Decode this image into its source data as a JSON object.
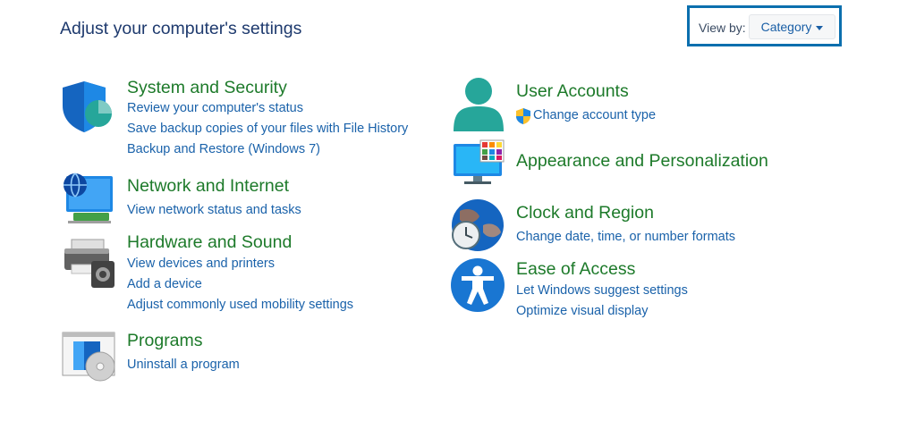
{
  "header": {
    "title": "Adjust your computer's settings",
    "view_by_label": "View by:",
    "view_by_value": "Category"
  },
  "categories": {
    "system": {
      "title": "System and Security",
      "icon": "shield-icon",
      "links": [
        "Review your computer's status",
        "Save backup copies of your files with File History",
        "Backup and Restore (Windows 7)"
      ]
    },
    "network": {
      "title": "Network and Internet",
      "icon": "network-globe-icon",
      "links": [
        "View network status and tasks"
      ]
    },
    "hardware": {
      "title": "Hardware and Sound",
      "icon": "printer-speaker-icon",
      "links": [
        "View devices and printers",
        "Add a device",
        "Adjust commonly used mobility settings"
      ]
    },
    "programs": {
      "title": "Programs",
      "icon": "programs-disc-icon",
      "links": [
        "Uninstall a program"
      ]
    },
    "accounts": {
      "title": "User Accounts",
      "icon": "user-icon",
      "links": [
        "Change account type"
      ]
    },
    "appearance": {
      "title": "Appearance and Personalization",
      "icon": "monitor-palette-icon",
      "links": []
    },
    "clock": {
      "title": "Clock and Region",
      "icon": "clock-globe-icon",
      "links": [
        "Change date, time, or number formats"
      ]
    },
    "ease": {
      "title": "Ease of Access",
      "icon": "accessibility-icon",
      "links": [
        "Let Windows suggest settings",
        "Optimize visual display"
      ]
    }
  },
  "colors": {
    "title_text": "#1e3a6e",
    "category_title": "#1d7a2a",
    "link": "#1a62aa",
    "highlight_border": "#0b6fae"
  }
}
